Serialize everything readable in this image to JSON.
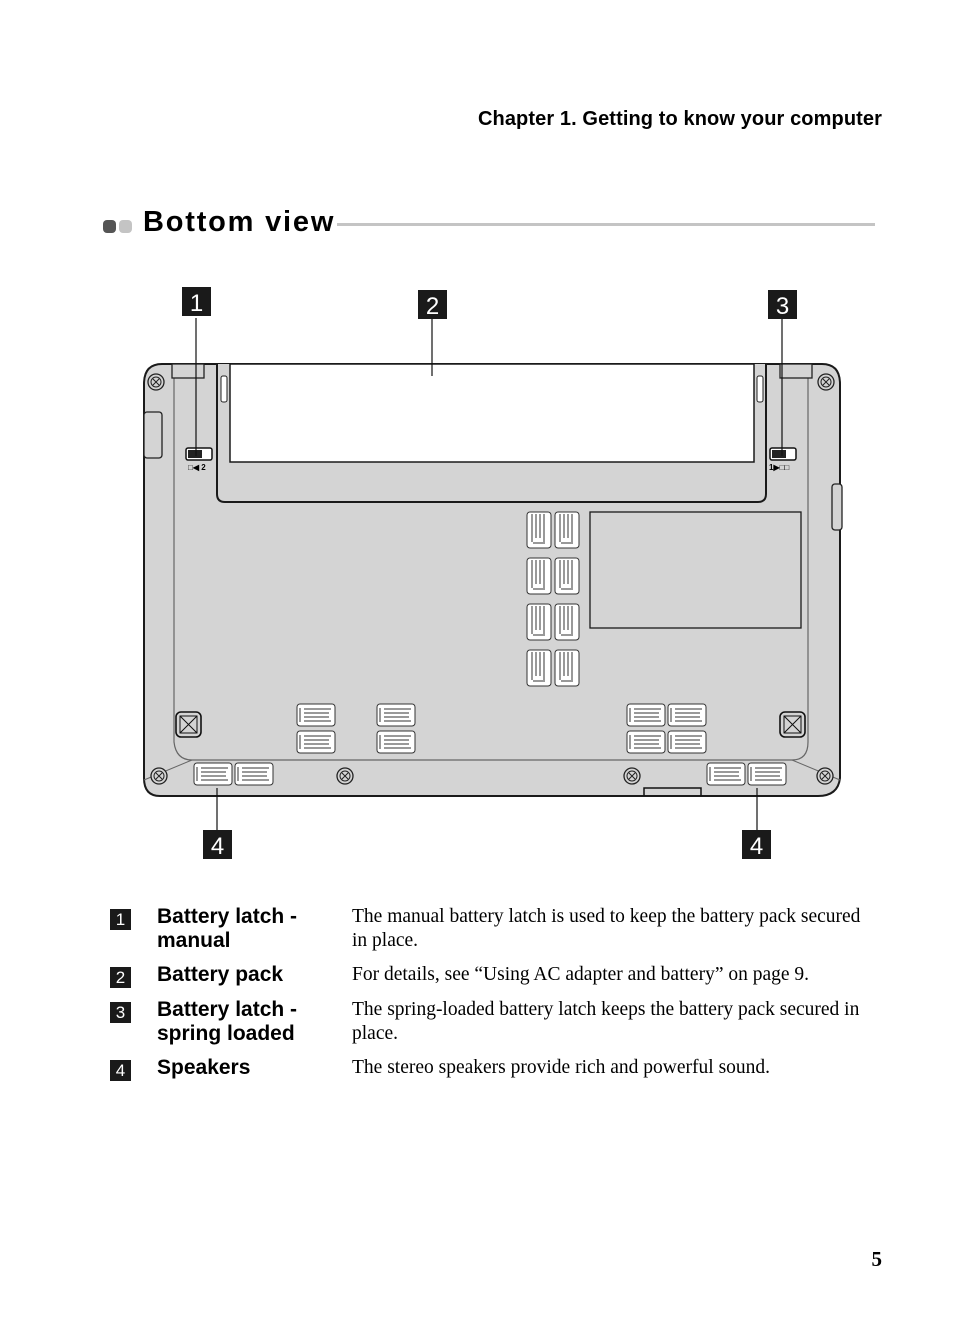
{
  "running_head": "Chapter 1. Getting to know your computer",
  "section": {
    "title": "Bottom view"
  },
  "diagram": {
    "callouts": [
      "1",
      "2",
      "3",
      "4",
      "4"
    ],
    "latch_manual_label": "☐◄ 2",
    "latch_spring_label": "1► ☐ ☐",
    "colors": {
      "body": "#d4d4d4",
      "outline": "#1a1a1a",
      "battery": "#ffffff",
      "badge": "#1a1a1a"
    }
  },
  "legend": [
    {
      "num": "1",
      "term": "Battery latch - manual",
      "description": "The manual battery latch is used to keep the battery pack secured in place."
    },
    {
      "num": "2",
      "term": "Battery pack",
      "description": "For details, see “Using AC adapter and battery” on page 9."
    },
    {
      "num": "3",
      "term": "Battery latch - spring loaded",
      "description": "The spring-loaded battery latch keeps the battery pack secured in place."
    },
    {
      "num": "4",
      "term": "Speakers",
      "description": "The stereo speakers provide rich and powerful sound."
    }
  ],
  "page_number": "5"
}
